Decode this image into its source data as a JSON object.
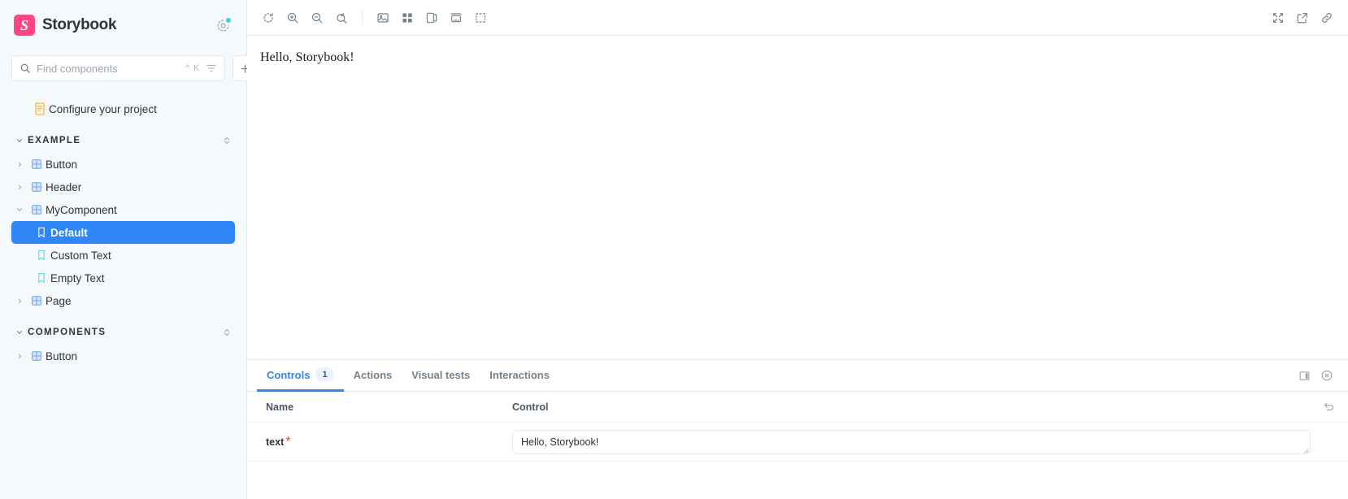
{
  "sidebar": {
    "brand": {
      "logo_letter": "S",
      "title": "Storybook",
      "logo_color": "#FF4785",
      "status_color": "#37D5D3"
    },
    "search": {
      "placeholder": "Find components",
      "value": "",
      "shortcut_modifier": "^",
      "shortcut_key": "K"
    },
    "add_button_label": "+",
    "docs_item": {
      "label": "Configure your project",
      "icon": "document-icon"
    },
    "groups": [
      {
        "label": "EXAMPLE",
        "items": [
          {
            "label": "Button",
            "type": "component",
            "expanded": false,
            "level": 1
          },
          {
            "label": "Header",
            "type": "component",
            "expanded": false,
            "level": 1
          },
          {
            "label": "MyComponent",
            "type": "component",
            "expanded": true,
            "level": 1
          },
          {
            "label": "Default",
            "type": "story",
            "level": 2,
            "selected": true
          },
          {
            "label": "Custom Text",
            "type": "story",
            "level": 2,
            "selected": false
          },
          {
            "label": "Empty Text",
            "type": "story",
            "level": 2,
            "selected": false
          },
          {
            "label": "Page",
            "type": "component",
            "expanded": false,
            "level": 1
          }
        ]
      },
      {
        "label": "COMPONENTS",
        "items": [
          {
            "label": "Button",
            "type": "component",
            "expanded": false,
            "level": 1
          }
        ]
      }
    ],
    "selected_accent": "#2E86F7"
  },
  "toolbar": {
    "left_buttons": [
      {
        "name": "remount-icon",
        "title": "Remount component"
      },
      {
        "name": "zoom-in-icon",
        "title": "Zoom in"
      },
      {
        "name": "zoom-out-icon",
        "title": "Zoom out"
      },
      {
        "name": "zoom-reset-icon",
        "title": "Reset zoom"
      }
    ],
    "addon_buttons": [
      {
        "name": "backgrounds-icon",
        "title": "Change background"
      },
      {
        "name": "grid-icon",
        "title": "Apply grid"
      },
      {
        "name": "theme-icon",
        "title": "Change theme"
      },
      {
        "name": "measure-icon",
        "title": "Enable measure"
      },
      {
        "name": "outline-icon",
        "title": "Apply outlines"
      }
    ],
    "right_buttons": [
      {
        "name": "fullscreen-icon",
        "title": "Go full screen"
      },
      {
        "name": "open-new-tab-icon",
        "title": "Open canvas in new tab"
      },
      {
        "name": "copy-link-icon",
        "title": "Copy canvas link"
      }
    ]
  },
  "canvas": {
    "preview_text": "Hello, Storybook!"
  },
  "panel": {
    "tabs": [
      {
        "label": "Controls",
        "badge": "1",
        "active": true
      },
      {
        "label": "Actions",
        "badge": "",
        "active": false
      },
      {
        "label": "Visual tests",
        "badge": "",
        "active": false
      },
      {
        "label": "Interactions",
        "badge": "",
        "active": false
      }
    ],
    "icons": [
      {
        "name": "panel-position-icon",
        "title": "Change addon orientation"
      },
      {
        "name": "close-panel-icon",
        "title": "Hide addons"
      }
    ],
    "controls_table": {
      "headers": {
        "name": "Name",
        "control": "Control"
      },
      "reset_icon": "reset-controls-icon",
      "rows": [
        {
          "name": "text",
          "required": true,
          "required_mark": "*",
          "control_type": "textarea",
          "value": "Hello, Storybook!"
        }
      ]
    },
    "accent": "#2E86F7"
  }
}
